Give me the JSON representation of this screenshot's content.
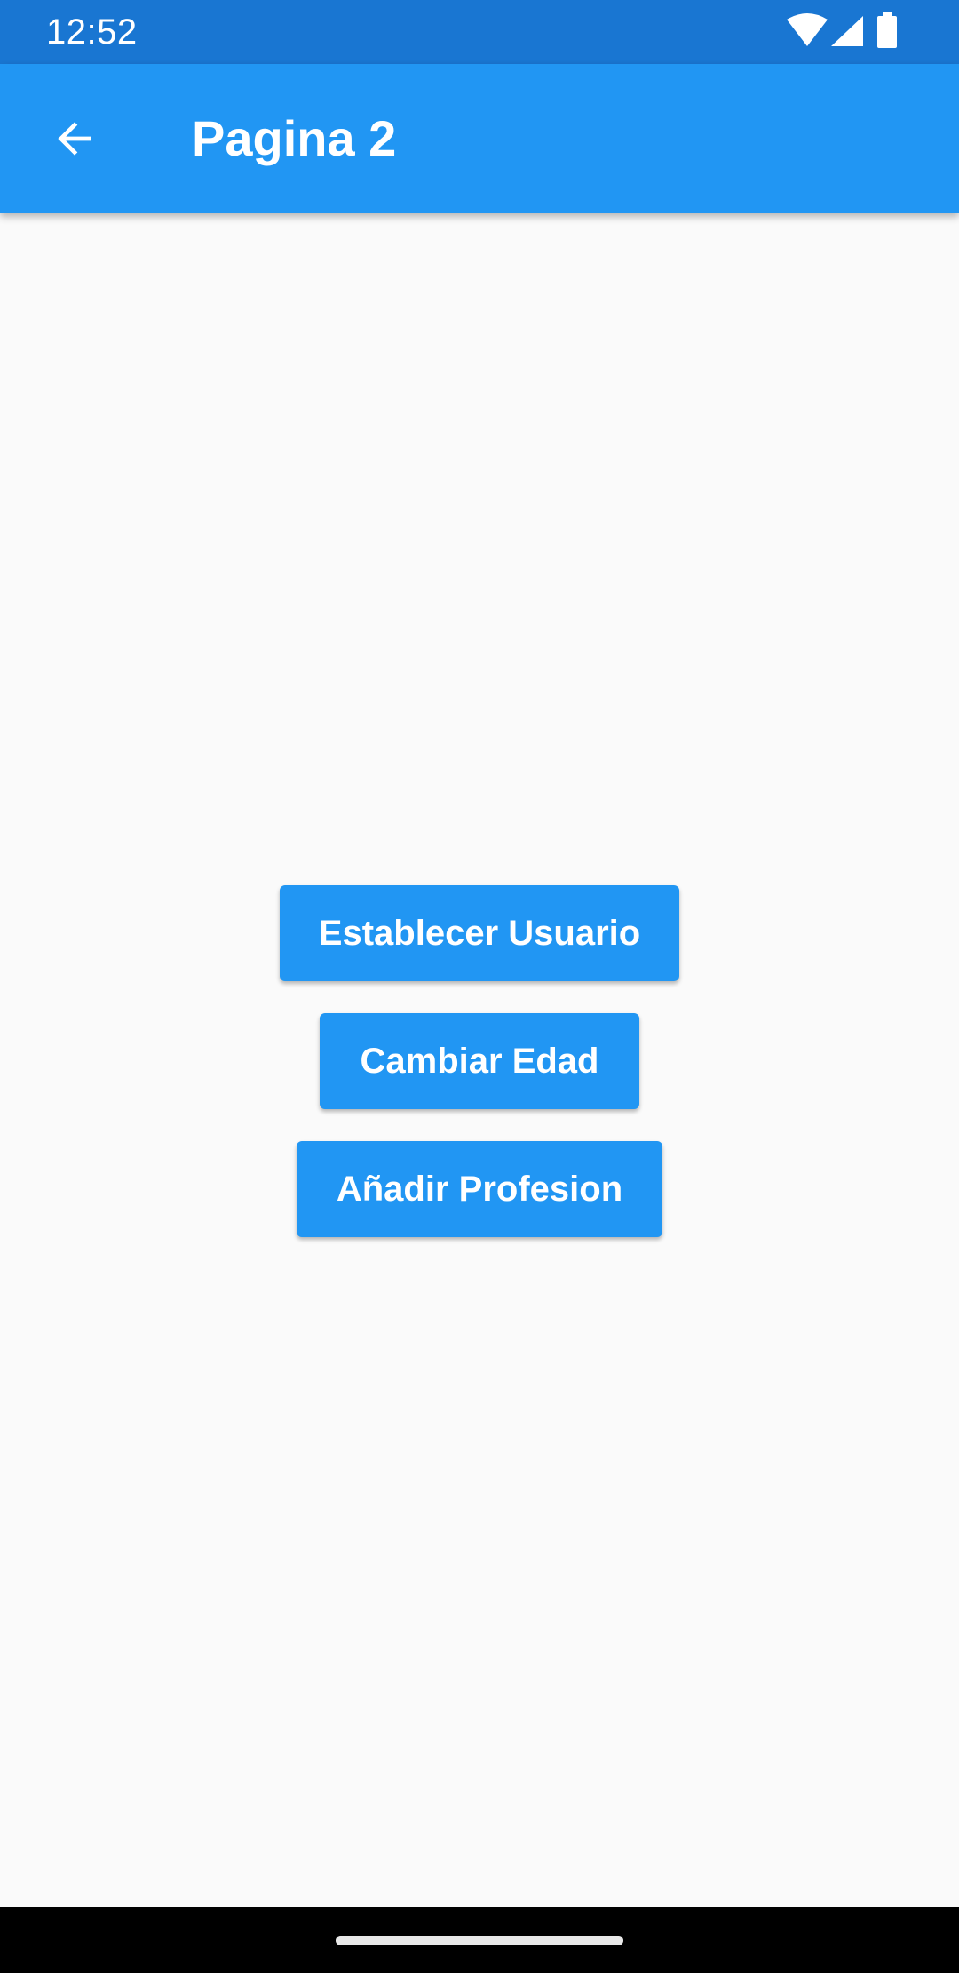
{
  "status_bar": {
    "time": "12:52",
    "icons": [
      "wifi-icon",
      "cell-signal-icon",
      "battery-icon"
    ],
    "color": "#1976d2"
  },
  "app_bar": {
    "title": "Pagina 2",
    "back_icon": "arrow-back-icon",
    "color": "#2196f3"
  },
  "buttons": [
    {
      "label": "Establecer Usuario"
    },
    {
      "label": "Cambiar Edad"
    },
    {
      "label": "Añadir Profesion"
    }
  ],
  "theme": {
    "primary": "#2196f3",
    "primary_dark": "#1976d2",
    "background": "#fafafa",
    "on_primary": "#ffffff"
  }
}
